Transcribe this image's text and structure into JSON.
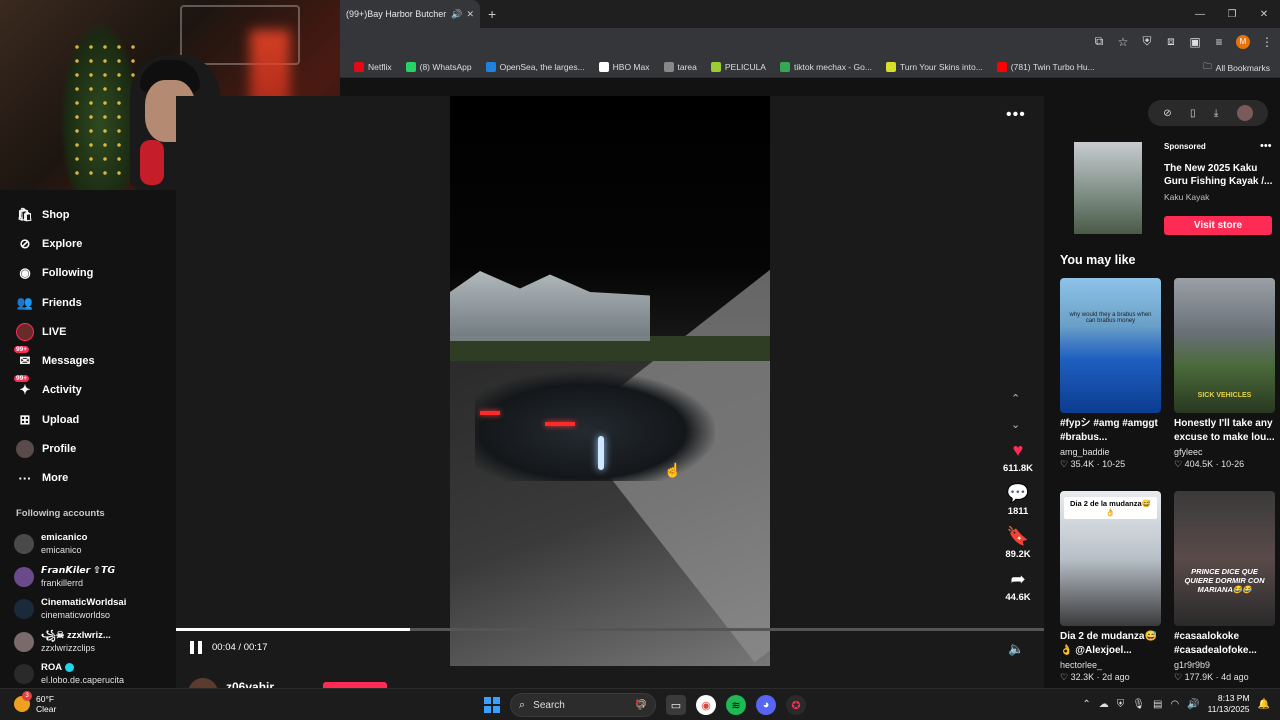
{
  "browser": {
    "tab_title": "(99+)Bay Harbor Butcher: T",
    "new_tab": "+",
    "bookmarks": [
      {
        "label": "Netflix",
        "color": "#e50914"
      },
      {
        "label": "(8) WhatsApp",
        "color": "#25d366"
      },
      {
        "label": "OpenSea, the larges...",
        "color": "#2081e2"
      },
      {
        "label": "HBO Max",
        "color": "#ffffff"
      },
      {
        "label": "tarea",
        "color": "#888888"
      },
      {
        "label": "PELICULA",
        "color": "#9acd32"
      },
      {
        "label": "tiktok mechax - Go...",
        "color": "#34a853"
      },
      {
        "label": "Turn Your Skins into...",
        "color": "#d4e02a"
      },
      {
        "label": "(781) Twin Turbo Hu...",
        "color": "#ff0000"
      }
    ],
    "all_bookmarks": "All Bookmarks",
    "profile_letter": "M"
  },
  "nav": {
    "items": [
      {
        "label": "Shop",
        "icon": "shop-icon"
      },
      {
        "label": "Explore",
        "icon": "explore-icon"
      },
      {
        "label": "Following",
        "icon": "following-icon"
      },
      {
        "label": "Friends",
        "icon": "friends-icon"
      },
      {
        "label": "LIVE",
        "icon": "live-icon"
      },
      {
        "label": "Messages",
        "icon": "messages-icon",
        "badge": "99+"
      },
      {
        "label": "Activity",
        "icon": "activity-icon",
        "badge": "99+"
      },
      {
        "label": "Upload",
        "icon": "upload-icon"
      },
      {
        "label": "Profile",
        "icon": "profile-icon"
      },
      {
        "label": "More",
        "icon": "more-icon"
      }
    ]
  },
  "following_accounts": {
    "title": "Following accounts",
    "items": [
      {
        "name": "emicanico",
        "handle": "emicanico",
        "color": "#4a4a4a"
      },
      {
        "name": "𝙁𝙧𝙖𝙣𝙆𝙞𝙡𝙚𝙧 ⇧𝙏𝙂",
        "handle": "frankillerrd",
        "color": "#6a4a8a"
      },
      {
        "name": "CinematicWorldsai",
        "handle": "cinematicworldso",
        "color": "#1a2a3a"
      },
      {
        "name": "꧁☠ zzxlwriz...",
        "handle": "zzxlwrizzclips",
        "color": "#7a6a6a"
      },
      {
        "name": "ROA",
        "handle": "el.lobo.de.caperucita",
        "color": "#2a2a2a",
        "verified": true
      }
    ]
  },
  "player": {
    "time_current": "00:04",
    "time_sep": " / ",
    "time_total": "00:17",
    "progress": 0.27,
    "likes": "611.8K",
    "comments": "1811",
    "saves": "89.2K",
    "shares": "44.6K",
    "author": "z06vahir"
  },
  "ad": {
    "sponsored": "Sponsored",
    "title": "The New 2025 Kaku Guru Fishing Kayak /...",
    "brand": "Kaku Kayak",
    "button": "Visit store"
  },
  "you_may_like": {
    "title": "You may like",
    "items": [
      {
        "caption": "#fypシ #amg #amggt #brabus...",
        "user": "amg_baddie",
        "likes": "35.4K",
        "date": "10-25"
      },
      {
        "caption": "Honestly I'll take any excuse to make lou...",
        "user": "gfyleec",
        "likes": "404.5K",
        "date": "10-26"
      },
      {
        "caption": "Dia 2 de mudanza😅👌 @Alexjoel...",
        "user": "hectorlee_",
        "likes": "32.3K",
        "date": "2d ago"
      },
      {
        "caption": "#casaalokoke #casadealofoke...",
        "user": "g1r9r9b9",
        "likes": "177.9K",
        "date": "4d ago"
      }
    ],
    "overlays": {
      "t1": "why would they a brabus when can brabus money",
      "t2": "SICK VEHICLES",
      "t3": "Dia 2 de la mudanza😅👌",
      "t4": "PRINCE DICE QUE QUIERE DORMIR CON MARIANA😂😂"
    }
  },
  "taskbar": {
    "weather_temp": "60°F",
    "weather_desc": "Clear",
    "weather_badge": "3",
    "search": "Search",
    "time": "8:13 PM",
    "date": "11/13/2025"
  }
}
